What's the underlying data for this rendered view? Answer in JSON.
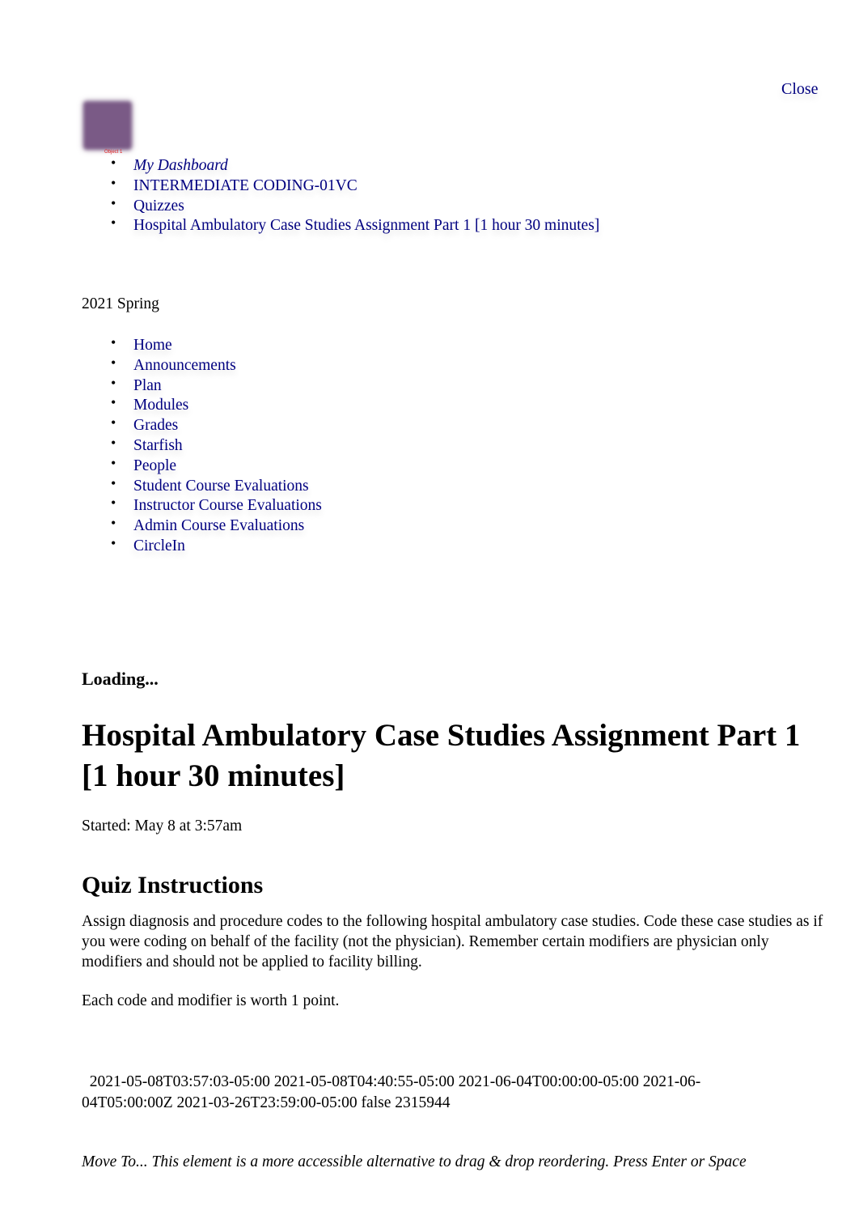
{
  "header": {
    "close_label": "Close",
    "logo_caption": "Object 1"
  },
  "breadcrumbs": [
    {
      "label": "My Dashboard"
    },
    {
      "label": "INTERMEDIATE CODING-01VC"
    },
    {
      "label": "Quizzes"
    },
    {
      "label": "Hospital Ambulatory Case Studies Assignment Part 1 [1 hour 30 minutes]"
    }
  ],
  "term": "2021 Spring",
  "course_nav": [
    {
      "label": "Home"
    },
    {
      "label": "Announcements"
    },
    {
      "label": "Plan"
    },
    {
      "label": "Modules"
    },
    {
      "label": "Grades"
    },
    {
      "label": "Starfish"
    },
    {
      "label": "People"
    },
    {
      "label": "Student Course Evaluations"
    },
    {
      "label": "Instructor Course Evaluations"
    },
    {
      "label": "Admin Course Evaluations"
    },
    {
      "label": "CircleIn"
    }
  ],
  "main": {
    "loading": "Loading...",
    "title": "Hospital Ambulatory Case Studies Assignment Part 1 [1 hour 30 minutes]",
    "started": "Started: May 8 at 3:57am",
    "instructions_heading": "Quiz Instructions",
    "instructions_text": "Assign diagnosis and procedure codes to the following hospital ambulatory case studies. Code these case studies as if you were coding on behalf of the facility (not the physician). Remember certain modifiers are physician only modifiers and should not be applied to facility billing.",
    "points_text": "Each code and modifier is worth 1 point.",
    "meta_text": "2021-05-08T03:57:03-05:00 2021-05-08T04:40:55-05:00 2021-06-04T00:00:00-05:00 2021-06-04T05:00:00Z 2021-03-26T23:59:00-05:00 false 2315944",
    "move_to_text": "Move To... This element is a more accessible alternative to drag & drop reordering. Press Enter or Space"
  }
}
